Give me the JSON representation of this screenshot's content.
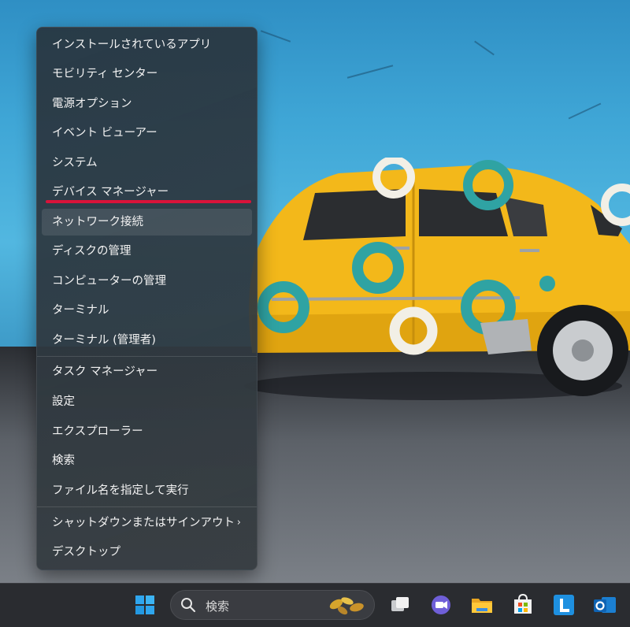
{
  "context_menu": {
    "items": [
      {
        "label": "インストールされているアプリ"
      },
      {
        "label": "モビリティ センター"
      },
      {
        "label": "電源オプション"
      },
      {
        "label": "イベント ビューアー"
      },
      {
        "label": "システム"
      },
      {
        "label": "デバイス マネージャー"
      },
      {
        "label": "ネットワーク接続"
      },
      {
        "label": "ディスクの管理"
      },
      {
        "label": "コンピューターの管理"
      },
      {
        "label": "ターミナル"
      },
      {
        "label": "ターミナル (管理者)"
      },
      {
        "label": "タスク マネージャー"
      },
      {
        "label": "設定"
      },
      {
        "label": "エクスプローラー"
      },
      {
        "label": "検索"
      },
      {
        "label": "ファイル名を指定して実行"
      },
      {
        "label": "シャットダウンまたはサインアウト",
        "submenu_arrow": "›"
      },
      {
        "label": "デスクトップ"
      }
    ],
    "highlighted_item": "デバイス マネージャー",
    "hovered_item": "ネットワーク接続",
    "annotation_color": "#d8133a"
  },
  "taskbar": {
    "search_placeholder": "検索",
    "icons": [
      "windows-start-icon",
      "search-icon",
      "task-view-icon",
      "teams-chat-icon",
      "file-explorer-icon",
      "microsoft-store-icon",
      "l-app-icon",
      "outlook-icon"
    ]
  },
  "colors": {
    "accent_blue": "#0a84ff",
    "annotation_red": "#d8133a",
    "taskbar_bg": "#2a2c30"
  }
}
